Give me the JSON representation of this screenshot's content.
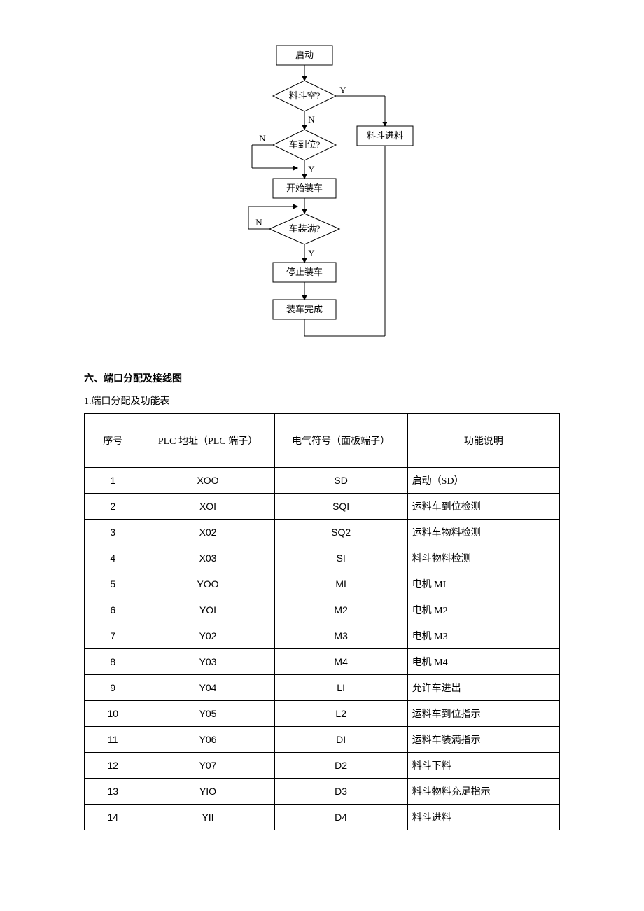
{
  "flow": {
    "start": "启动",
    "d1": "料斗空?",
    "d2": "车到位?",
    "p_feed": "料斗进料",
    "p_load": "开始装车",
    "d3": "车装满?",
    "p_stop": "停止装车",
    "p_done": "装车完成",
    "y": "Y",
    "n": "N"
  },
  "heading": "六、端口分配及接线图",
  "sub": "1.端口分配及功能表",
  "table": {
    "headers": {
      "seq": "序号",
      "plc": "PLC 地址（PLC 端子）",
      "elec": "电气符号（面板端子）",
      "desc": "功能说明"
    },
    "rows": [
      {
        "seq": "1",
        "plc": "XOO",
        "elec": "SD",
        "desc": "启动（SD）"
      },
      {
        "seq": "2",
        "plc": "XOI",
        "elec": "SQI",
        "desc": "运料车到位检测"
      },
      {
        "seq": "3",
        "plc": "X02",
        "elec": "SQ2",
        "desc": "运料车物料检测"
      },
      {
        "seq": "4",
        "plc": "X03",
        "elec": "SI",
        "desc": "料斗物料检测"
      },
      {
        "seq": "5",
        "plc": "YOO",
        "elec": "MI",
        "desc": "电机 MI"
      },
      {
        "seq": "6",
        "plc": "YOI",
        "elec": "M2",
        "desc": "电机 M2"
      },
      {
        "seq": "7",
        "plc": "Y02",
        "elec": "M3",
        "desc": "电机 M3"
      },
      {
        "seq": "8",
        "plc": "Y03",
        "elec": "M4",
        "desc": "电机 M4"
      },
      {
        "seq": "9",
        "plc": "Y04",
        "elec": "LI",
        "desc": "允许车进出"
      },
      {
        "seq": "10",
        "plc": "Y05",
        "elec": "L2",
        "desc": "运料车到位指示"
      },
      {
        "seq": "11",
        "plc": "Y06",
        "elec": "DI",
        "desc": "运料车装满指示"
      },
      {
        "seq": "12",
        "plc": "Y07",
        "elec": "D2",
        "desc": "料斗下料"
      },
      {
        "seq": "13",
        "plc": "YIO",
        "elec": "D3",
        "desc": "料斗物料充足指示"
      },
      {
        "seq": "14",
        "plc": "YII",
        "elec": "D4",
        "desc": "料斗进料"
      }
    ]
  }
}
